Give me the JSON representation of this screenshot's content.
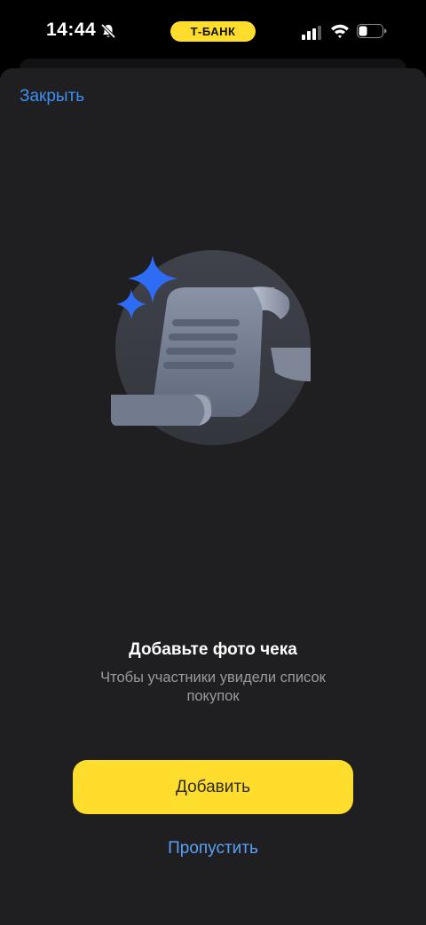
{
  "status_bar": {
    "time": "14:44",
    "carrier": "Т-БАНК",
    "icons": [
      "bell-slash-icon",
      "signal-icon",
      "wifi-icon",
      "battery-icon"
    ]
  },
  "header": {
    "close_label": "Закрыть"
  },
  "illustration": {
    "icon": "receipt-scroll-icon",
    "accent_icon": "sparkle-icon"
  },
  "content": {
    "title": "Добавьте фото чека",
    "subtitle": "Чтобы участники увидели список покупок"
  },
  "actions": {
    "add_label": "Добавить",
    "skip_label": "Пропустить"
  },
  "colors": {
    "background": "#1f1f21",
    "accent_yellow": "#ffdd2d",
    "link_blue": "#3d8ef5",
    "sparkle_blue": "#2f6cf6"
  }
}
